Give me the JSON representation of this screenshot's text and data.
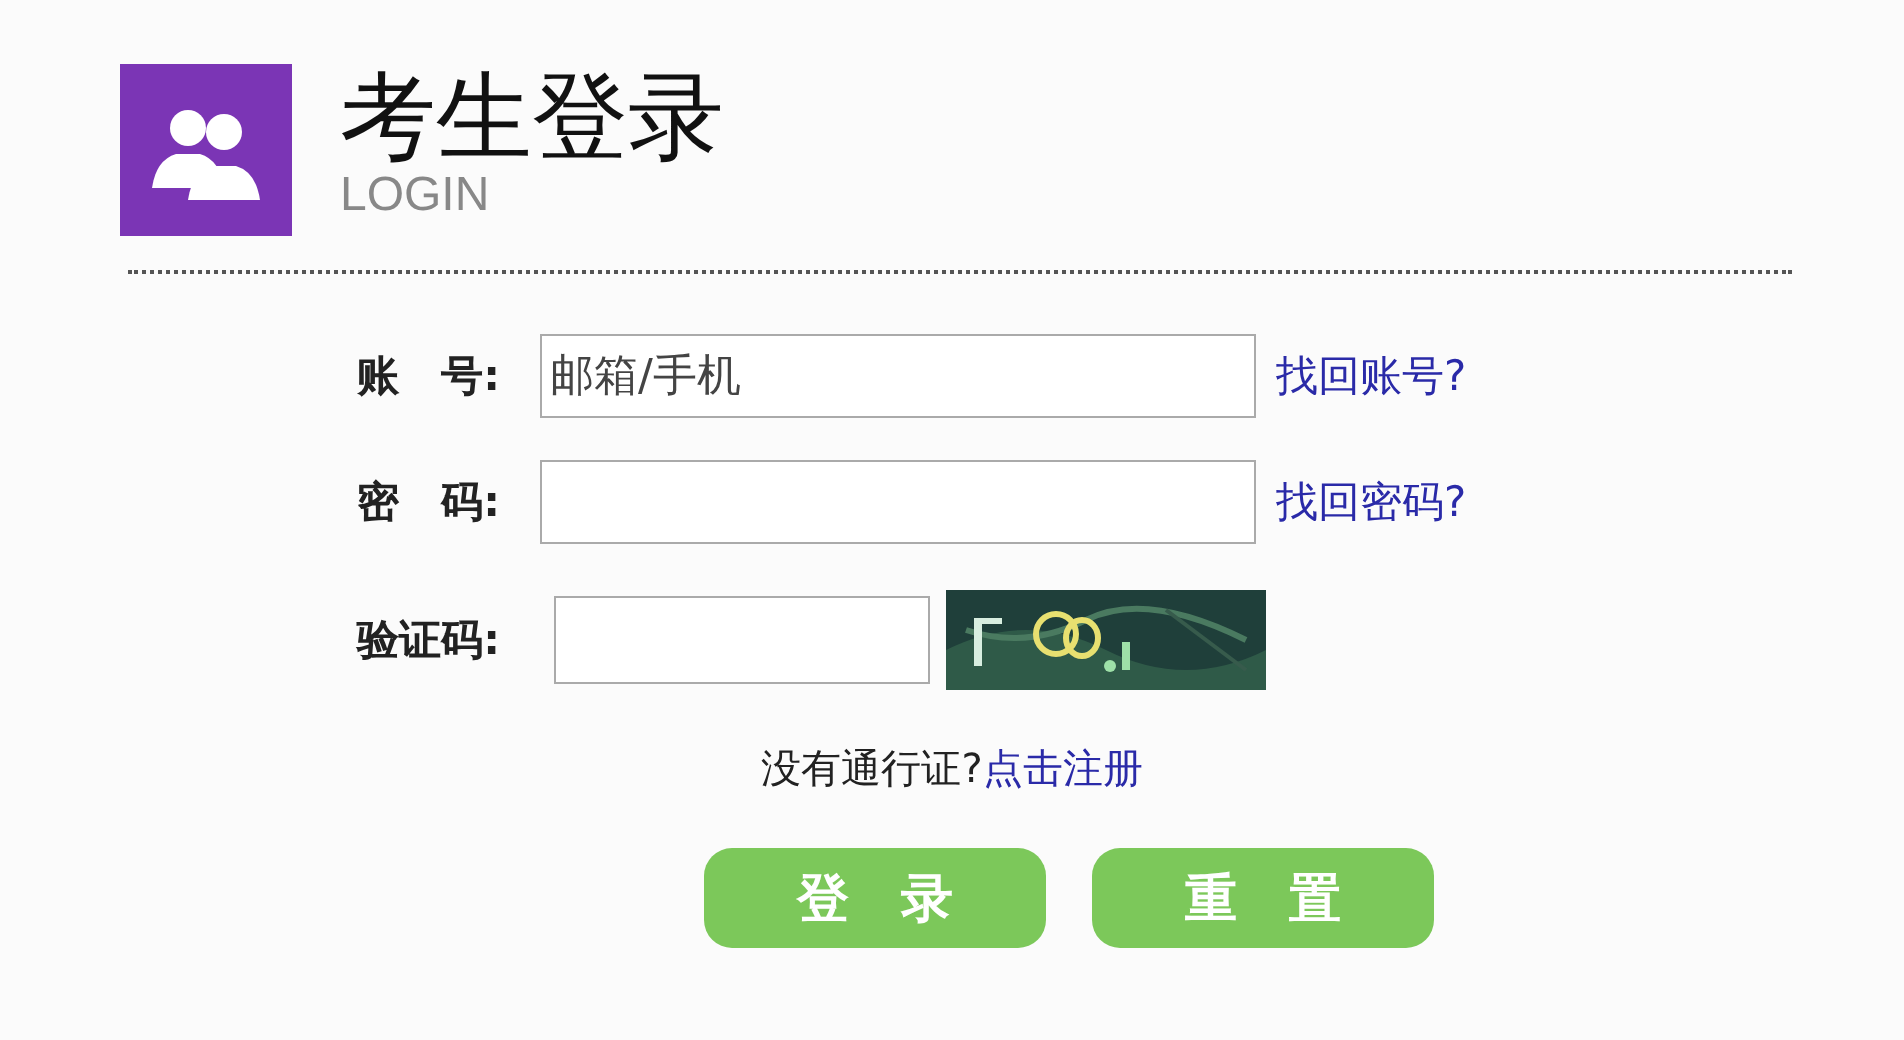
{
  "header": {
    "title": "考生登录",
    "subtitle": "LOGIN"
  },
  "fields": [
    {
      "kind": "text",
      "label": "账　号:",
      "placeholder": "邮箱/手机",
      "link": "找回账号?"
    },
    {
      "kind": "password",
      "label": "密　码:",
      "link": "找回密码?"
    },
    {
      "kind": "captcha",
      "label": "验证码:"
    }
  ],
  "register": {
    "text": "没有通行证?",
    "link": "点击注册"
  },
  "buttons": [
    "登　录",
    "重　置"
  ]
}
